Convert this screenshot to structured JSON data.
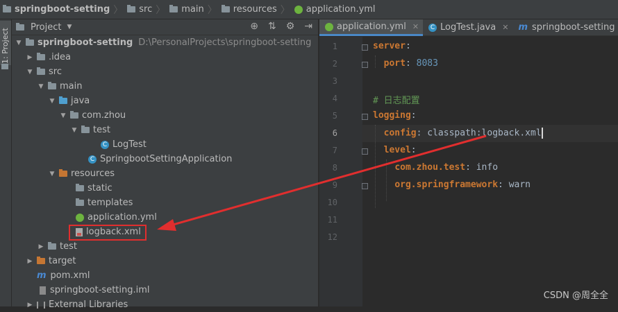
{
  "breadcrumb": {
    "items": [
      {
        "label": "springboot-setting",
        "bold": true
      },
      {
        "label": "src"
      },
      {
        "label": "main"
      },
      {
        "label": "resources"
      },
      {
        "label": "application.yml"
      }
    ]
  },
  "sidebar_tab": {
    "label": "1: Project"
  },
  "project_panel": {
    "title": "Project",
    "tree": [
      {
        "label": "springboot-setting",
        "path": "D:\\PersonalProjects\\springboot-setting"
      },
      {
        "label": ".idea"
      },
      {
        "label": "src"
      },
      {
        "label": "main"
      },
      {
        "label": "java"
      },
      {
        "label": "com.zhou"
      },
      {
        "label": "test"
      },
      {
        "label": "LogTest"
      },
      {
        "label": "SpringbootSettingApplication"
      },
      {
        "label": "resources"
      },
      {
        "label": "static"
      },
      {
        "label": "templates"
      },
      {
        "label": "application.yml"
      },
      {
        "label": "logback.xml"
      },
      {
        "label": "test"
      },
      {
        "label": "target"
      },
      {
        "label": "pom.xml"
      },
      {
        "label": "springboot-setting.iml"
      },
      {
        "label": "External Libraries"
      }
    ]
  },
  "editor": {
    "tabs": [
      {
        "label": "application.yml",
        "active": true
      },
      {
        "label": "LogTest.java"
      },
      {
        "label": "springboot-setting"
      }
    ],
    "line_numbers": [
      "1",
      "2",
      "3",
      "4",
      "5",
      "6",
      "7",
      "8",
      "9",
      "10",
      "11",
      "12"
    ],
    "code": {
      "l1_key": "server",
      "l2_key": "port",
      "l2_val": "8083",
      "l4_comment": "# 日志配置",
      "l5_key": "logging",
      "l6_key": "config",
      "l6_val": "classpath:logback.xml",
      "l7_key": "level",
      "l8_key": "com.zhou.test",
      "l8_val": "info",
      "l9_key": "org.springframework",
      "l9_val": "warn"
    }
  },
  "watermark": "CSDN @周全全",
  "colors": {
    "annotation_red": "#e12e2e",
    "keyword": "#cc7832",
    "number": "#6897bb",
    "comment": "#629755"
  }
}
